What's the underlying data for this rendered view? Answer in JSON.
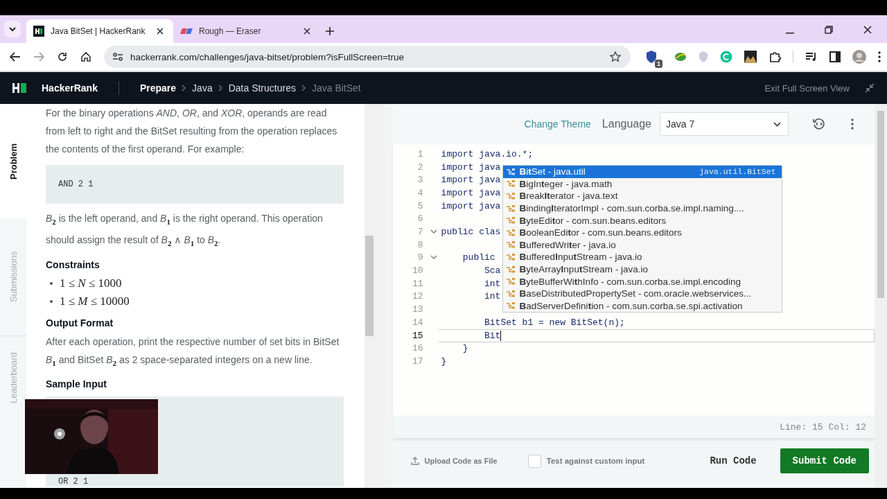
{
  "browser": {
    "tabs": [
      {
        "title": "Java BitSet | HackerRank",
        "selected": true,
        "kind": "hackerrank"
      },
      {
        "title": "Rough — Eraser",
        "selected": false,
        "kind": "eraser"
      }
    ],
    "address": "hackerrank.com/challenges/java-bitset/problem?isFullScreen=true",
    "extension_badge": "1"
  },
  "nav": {
    "logo": "HackerRank",
    "breadcrumbs": [
      {
        "label": "Prepare",
        "current": false
      },
      {
        "label": "Java",
        "current": false
      },
      {
        "label": "Data Structures",
        "current": false
      },
      {
        "label": "Java BitSet",
        "current": true
      }
    ],
    "exit": "Exit Full Screen View"
  },
  "side_tabs": [
    {
      "label": "Problem",
      "selected": true
    },
    {
      "label": "Submissions",
      "selected": false
    },
    {
      "label": "Leaderboard",
      "selected": false
    }
  ],
  "problem": [
    {
      "kind": "paragraph",
      "text": "For the binary operations *AND*, *OR*, and *XOR*, operands are read from left to right and the BitSet resulting from the operation replaces the contents of the first operand. For example:"
    },
    {
      "kind": "code",
      "text": "AND 2 1"
    },
    {
      "kind": "paragraph",
      "text": "*B*$_{2}$ is the left operand, and *B*$_{1}$ is the right operand. This operation should assign the result of *B*$_{2}$ ∧ *B*$_{1}$ to *B*$_{2}$."
    },
    {
      "kind": "heading",
      "text": "Constraints"
    },
    {
      "kind": "list",
      "items": [
        "1 ≤ *N* ≤ 1000",
        "1 ≤ *M* ≤ 10000"
      ]
    },
    {
      "kind": "heading",
      "text": "Output Format"
    },
    {
      "kind": "paragraph",
      "text": "After each operation, print the respective number of set bits in BitSet *B*$_{1}$ and BitSet *B*$_{2}$ as 2 space-separated integers on a new line."
    },
    {
      "kind": "heading",
      "text": "Sample Input"
    },
    {
      "kind": "code_tail",
      "text": "OR 2 1"
    }
  ],
  "editor": {
    "change_theme": "Change Theme",
    "language_label": "Language",
    "language": "Java 7",
    "lines": [
      {
        "number": "1",
        "text": "import java.io.*;",
        "current": false,
        "fold": false
      },
      {
        "number": "2",
        "text": "import java",
        "current": false,
        "fold": false
      },
      {
        "number": "3",
        "text": "import java",
        "current": false,
        "fold": false
      },
      {
        "number": "4",
        "text": "import java",
        "current": false,
        "fold": false
      },
      {
        "number": "5",
        "text": "import java",
        "current": false,
        "fold": false
      },
      {
        "number": "6",
        "current": false,
        "fold": false
      },
      {
        "number": "7",
        "text": "public clas",
        "current": false,
        "fold": true
      },
      {
        "number": "8",
        "current": false,
        "fold": false
      },
      {
        "number": "9",
        "text": "    public",
        "current": false,
        "fold": true
      },
      {
        "number": "10",
        "text": "        Sca",
        "current": false,
        "fold": false
      },
      {
        "number": "11",
        "text": "        int",
        "current": false,
        "fold": false
      },
      {
        "number": "12",
        "text": "        int",
        "current": false,
        "fold": false
      },
      {
        "number": "13",
        "current": false,
        "fold": false
      },
      {
        "number": "14",
        "text": "        BitSet b1 = new BitSet(n);",
        "current": false,
        "fold": false
      },
      {
        "number": "15",
        "text": "        Bit",
        "current": true,
        "fold": false
      },
      {
        "number": "16",
        "text": "    }",
        "current": false,
        "fold": false
      },
      {
        "number": "17",
        "text": "}",
        "current": false,
        "fold": false
      }
    ],
    "autocomplete": [
      {
        "label": "**B**i**t**Set - java.util",
        "detail": "java.util.BitSet",
        "selected": true
      },
      {
        "label": "**B**igIn**t**eger - java.math",
        "selected": false
      },
      {
        "label": "**B**reak**It**erator - java.text",
        "selected": false
      },
      {
        "label": "**B**inding**I**teratorImpl - com.sun.corba.se.impl.naming....",
        "selected": false
      },
      {
        "label": "**B**yteEdi**t**or - com.sun.beans.editors",
        "selected": false
      },
      {
        "label": "**B**ooleanEdi**t**or - com.sun.beans.editors",
        "selected": false
      },
      {
        "label": "**B**ufferedWri**t**er - java.io",
        "selected": false
      },
      {
        "label": "**B**uffered**I**npu**t**Stream - java.io",
        "selected": false
      },
      {
        "label": "**B**yteArray**I**npu**t**Stream - java.io",
        "selected": false
      },
      {
        "label": "**B**yteBufferWi**t**hInfo - com.sun.corba.se.impl.encoding",
        "selected": false
      },
      {
        "label": "**B**aseDistributedPropertySet - com.oracle.webservices...",
        "selected": false
      },
      {
        "label": "**B**adServerDefini**t**ion - com.sun.corba.se.spi.activation",
        "selected": false
      }
    ],
    "status": "Line: 15 Col: 12"
  },
  "footer": {
    "upload": "Upload Code as File",
    "custom_input": {
      "label": "Test against custom input",
      "checked": false
    },
    "run": "Run Code",
    "submit": "Submit Code"
  }
}
